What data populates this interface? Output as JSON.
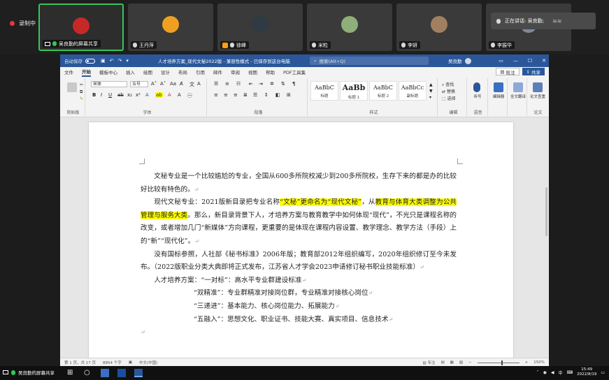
{
  "meeting": {
    "recording_label": "录制中",
    "participants": [
      {
        "name": "吴良勤的屏幕共享",
        "avatar_color": "#c62828",
        "active": true
      },
      {
        "name": "王丹萍",
        "avatar_color": "#f0a020",
        "active": false
      },
      {
        "name": "徐峰",
        "avatar_color": "#2f3a45",
        "active": false
      },
      {
        "name": "米粒",
        "avatar_color": "#8fae7a",
        "active": false
      },
      {
        "name": "李妍",
        "avatar_color": "#a08060",
        "active": false
      },
      {
        "name": "李振华",
        "avatar_color": "#7a8a9a",
        "active": false
      }
    ],
    "speaking_label": "正在讲话: 吴良勤;"
  },
  "word": {
    "autosave_label": "自动保存",
    "doc_title": "人才培养方案_现代文秘2022版 - 兼容性模式 - 已保存到这台电脑",
    "search_placeholder": "搜索(Alt+Q)",
    "user_name": "吴良勤",
    "tabs": [
      "文件",
      "开始",
      "模板中心",
      "插入",
      "绘图",
      "设计",
      "布局",
      "引用",
      "邮件",
      "审阅",
      "视图",
      "帮助",
      "PDF工具集"
    ],
    "active_tab": "开始",
    "comment_button": "批注",
    "share_button": "共享",
    "ribbon": {
      "clipboard_label": "剪贴板",
      "font_label": "字体",
      "paragraph_label": "段落",
      "styles_label": "样式",
      "editing_label": "编辑",
      "voice_label": "语音",
      "font_name": "宋体",
      "font_size": "五号",
      "styles": [
        {
          "preview": "AaBbC",
          "name": "标题"
        },
        {
          "preview": "AaBb",
          "name": "标题 1"
        },
        {
          "preview": "AaBbC",
          "name": "标题 2"
        },
        {
          "preview": "AaBbCc",
          "name": "副标题"
        }
      ],
      "find_label": "查找",
      "replace_label": "替换",
      "select_label": "选择",
      "dictate_label": "听写",
      "editor_label": "编辑器",
      "translate_label": "全文翻译",
      "check_label": "论文查重",
      "paper_label": "论文"
    },
    "document": {
      "p1": "文秘专业是一个比较尴尬的专业，全国从600多所院校减少到200多所院校，生存下来的都是办的比较好比较有特色的。",
      "p2_a": "现代文秘专业：2021版新目录把专业名称",
      "p2_hl1": "“文秘”更命名为“现代文秘”",
      "p2_b": "，从",
      "p2_hl2": "教育与体育大类调整为公共管理与服务大类",
      "p2_c": "。那么，新目录背景下人，才培养方案与教育教学中如何体现“现代”，不光只是课程名称的改变，或者增加几门“新媒体”方向课程，更重要的是体现在课程内容设置、教学理念、教学方法（手段）上的“新”“现代化”。",
      "p3": "没有国标参照，人社部《秘书标准》2006年版；教育部2012年组织编写，2020年组织修订至今未发布。（2022版职业分类大典即将正式发布，江苏省人才学会2023申请修订秘书职业技能标准）",
      "plan_intro": "人才培养方案：“一对标”：高水平专业群建设标准",
      "plan_items": [
        "“双精准”：专业群精准对接岗位群，专业精准对接核心岗位",
        "“三递进”：基本能力、核心岗位能力、拓展能力",
        "“五融入”：思想文化、职业证书、技能大赛、真实项目、信息技术"
      ]
    },
    "status": {
      "page": "第 1 页，共 17 页",
      "words": "8854 个字",
      "language": "中文(中国)",
      "focus": "专注",
      "zoom": "150%"
    }
  },
  "taskbar": {
    "share_label": "吴良勤的屏幕共享",
    "time": "15:49",
    "date": "2022/8/19",
    "ime": "中"
  }
}
